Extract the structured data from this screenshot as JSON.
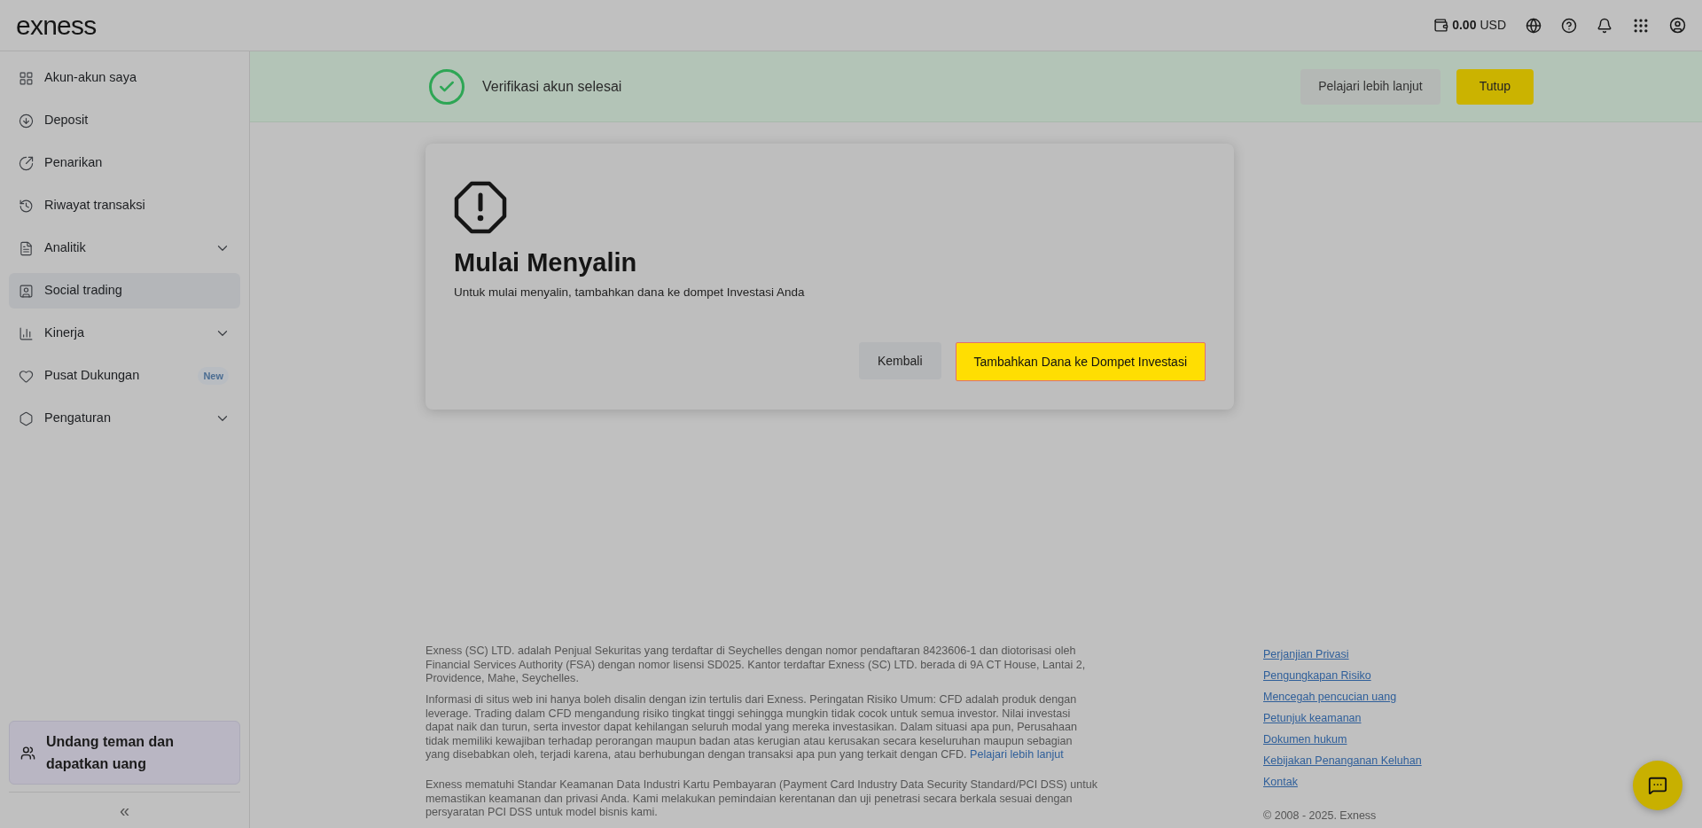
{
  "header": {
    "logo": "exness",
    "balance_amount": "0.00",
    "balance_currency": "USD"
  },
  "sidebar": {
    "items": [
      {
        "label": "Akun-akun saya",
        "selected": false,
        "expandable": false
      },
      {
        "label": "Deposit",
        "selected": false,
        "expandable": false
      },
      {
        "label": "Penarikan",
        "selected": false,
        "expandable": false
      },
      {
        "label": "Riwayat transaksi",
        "selected": false,
        "expandable": false
      },
      {
        "label": "Analitik",
        "selected": false,
        "expandable": true
      },
      {
        "label": "Social trading",
        "selected": true,
        "expandable": false
      },
      {
        "label": "Kinerja",
        "selected": false,
        "expandable": true
      },
      {
        "label": "Pusat Dukungan",
        "selected": false,
        "expandable": false,
        "badge": "New"
      },
      {
        "label": "Pengaturan",
        "selected": false,
        "expandable": true
      }
    ],
    "invite": "Undang teman dan dapatkan uang",
    "collapse": "«"
  },
  "banner": {
    "message": "Verifikasi akun selesai",
    "learn_more": "Pelajari lebih lanjut",
    "close": "Tutup"
  },
  "dialog": {
    "title": "Mulai Menyalin",
    "text": "Untuk mulai menyalin, tambahkan dana ke dompet Investasi Anda",
    "back": "Kembali",
    "primary": "Tambahkan Dana ke Dompet Investasi"
  },
  "footer": {
    "paragraphs": [
      {
        "text": "Exness (SC) LTD. adalah Penjual Sekuritas yang terdaftar di Seychelles dengan nomor pendaftaran 8423606-1 dan diotorisasi oleh Financial Services Authority (FSA) dengan nomor lisensi SD025. Kantor terdaftar Exness (SC) LTD. berada di 9A CT House, Lantai 2, Providence, Mahe, Seychelles."
      },
      {
        "text": "Informasi di situs web ini hanya boleh disalin dengan izin tertulis dari Exness. Peringatan Risiko Umum: CFD adalah produk dengan leverage. Trading dalam CFD mengandung risiko tingkat tinggi sehingga mungkin tidak cocok untuk semua investor. Nilai investasi dapat naik dan turun, serta investor dapat kehilangan seluruh modal yang mereka investasikan. Dalam situasi apa pun, Perusahaan tidak memiliki kewajiban terhadap perorangan maupun badan atas kerugian atau kerusakan secara keseluruhan maupun sebagian yang disebabkan oleh, terjadi karena, atau berhubungan dengan transaksi apa pun yang terkait dengan CFD.",
        "link": "Pelajari lebih lanjut"
      },
      {
        "text": "Exness mematuhi Standar Keamanan Data Industri Kartu Pembayaran (Payment Card Industry Data Security Standard/PCI DSS) untuk memastikan keamanan dan privasi Anda. Kami melakukan pemindaian kerentanan dan uji penetrasi secara berkala sesuai dengan persyaratan PCI DSS untuk model bisnis kami."
      }
    ],
    "links": [
      "Perjanjian Privasi",
      "Pengungkapan Risiko",
      "Mencegah pencucian uang",
      "Petunjuk keamanan",
      "Dokumen hukum",
      "Kebijakan Penanganan Keluhan",
      "Kontak"
    ],
    "copyright": "© 2008 - 2025. Exness"
  }
}
